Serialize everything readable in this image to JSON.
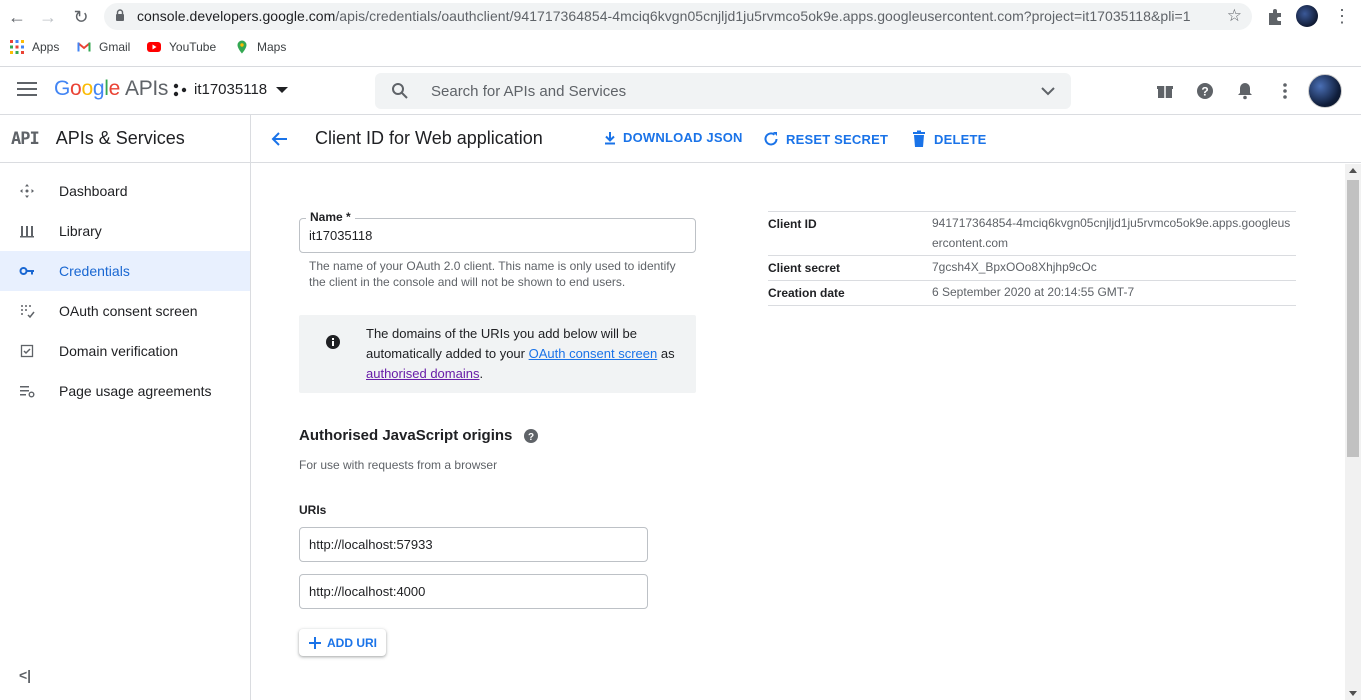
{
  "browser": {
    "url_host": "console.developers.google.com",
    "url_rest": "/apis/credentials/oauthclient/941717364854-4mciq6kvgn05cnjljd1ju5rvmco5ok9e.apps.googleusercontent.com?project=it17035118&pli=1",
    "bookmarks": [
      {
        "label": "Apps",
        "icon": "apps-grid-icon"
      },
      {
        "label": "Gmail",
        "icon": "gmail-icon"
      },
      {
        "label": "YouTube",
        "icon": "youtube-icon"
      },
      {
        "label": "Maps",
        "icon": "maps-icon"
      }
    ]
  },
  "header": {
    "logo_apis": "APIs",
    "project": "it17035118",
    "search_placeholder": "Search for APIs and Services"
  },
  "sidebar": {
    "badge": "API",
    "title": "APIs & Services",
    "items": [
      {
        "label": "Dashboard",
        "icon": "dashboard-icon",
        "active": false
      },
      {
        "label": "Library",
        "icon": "library-icon",
        "active": false
      },
      {
        "label": "Credentials",
        "icon": "key-icon",
        "active": true
      },
      {
        "label": "OAuth consent screen",
        "icon": "consent-icon",
        "active": false
      },
      {
        "label": "Domain verification",
        "icon": "domain-check-icon",
        "active": false
      },
      {
        "label": "Page usage agreements",
        "icon": "settings-list-icon",
        "active": false
      }
    ],
    "collapse": "<|"
  },
  "actions": {
    "title": "Client ID for Web application",
    "download": "DOWNLOAD JSON",
    "reset": "RESET SECRET",
    "delete": "DELETE"
  },
  "form": {
    "name_label": "Name *",
    "name_value": "it17035118",
    "name_hint": "The name of your OAuth 2.0 client. This name is only used to identify the client in the console and will not be shown to end users.",
    "info_text_1": "The domains of the URIs you add below will be automatically added to your ",
    "info_link_1": "OAuth consent screen",
    "info_text_2": " as ",
    "info_link_2": "authorised domains",
    "info_text_3": ".",
    "origins_title": "Authorised JavaScript origins",
    "origins_sub": "For use with requests from a browser",
    "uris_label": "URIs",
    "uris": [
      "http://localhost:57933",
      "http://localhost:4000"
    ],
    "add_uri": "ADD URI"
  },
  "details": [
    {
      "key": "Client ID",
      "value": "941717364854-4mciq6kvgn05cnjljd1ju5rvmco5ok9e.apps.googleusercontent.com"
    },
    {
      "key": "Client secret",
      "value": "7gcsh4X_BpxOOo8Xhjhp9cOc"
    },
    {
      "key": "Creation date",
      "value": "6 September 2020 at 20:14:55 GMT-7"
    }
  ],
  "colors": {
    "accent": "#1a73e8",
    "active_bg": "#e8f0fe",
    "visited_link": "#681da8"
  }
}
